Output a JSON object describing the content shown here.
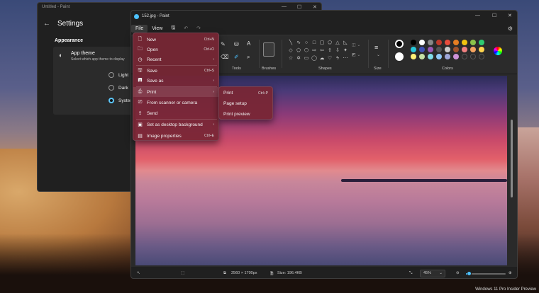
{
  "desktop": {
    "watermark": "Windows 11 Pro Insider Preview"
  },
  "settings": {
    "window_title": "Untitled - Paint",
    "controls": {
      "min": "—",
      "max": "☐",
      "close": "✕"
    },
    "back_icon": "arrow-left-icon",
    "title": "Settings",
    "section": "Appearance",
    "card": {
      "title": "App theme",
      "subtitle": "Select which app theme to display",
      "icon": "palette-icon"
    },
    "options": [
      {
        "label": "Light",
        "selected": false
      },
      {
        "label": "Dark",
        "selected": false
      },
      {
        "label": "System setting",
        "selected": true
      }
    ]
  },
  "paint": {
    "title": "152.jpg - Paint",
    "controls": {
      "min": "—",
      "max": "☐",
      "close": "✕"
    },
    "menu": {
      "file": "File",
      "view": "View"
    },
    "ribbon": {
      "tools_label": "Tools",
      "brushes_label": "Brushes",
      "shapes_label": "Shapes",
      "size_label": "Size",
      "colors_label": "Colors"
    },
    "colors": {
      "primary": "#000000",
      "secondary": "#ffffff",
      "palette": [
        "#000000",
        "#ffffff",
        "#888888",
        "#c0392b",
        "#e74c3c",
        "#e67e22",
        "#f1c40f",
        "#8bc34a",
        "#2ecc71",
        "#26c6da",
        "#3f51b5",
        "#9b59b6",
        "#555555",
        "#cccccc",
        "#a0522d",
        "#f08080",
        "#f4a460",
        "#ffd54f",
        "#fff176",
        "#c5e1a5",
        "#80deea",
        "#90caf9",
        "#9fa8da",
        "#ce93d8"
      ]
    },
    "status": {
      "dimensions": "2560 × 1700px",
      "size": "Size: 196.4KB",
      "zoom": "45%",
      "zoom_fraction": 0.08
    }
  },
  "file_menu": {
    "items": [
      {
        "label": "New",
        "shortcut": "Ctrl+N",
        "icon": "new-file-icon"
      },
      {
        "label": "Open",
        "shortcut": "Ctrl+O",
        "icon": "folder-icon"
      },
      {
        "label": "Recent",
        "shortcut": "›",
        "icon": "clock-icon"
      },
      {
        "label": "Save",
        "shortcut": "Ctrl+S",
        "icon": "save-icon"
      },
      {
        "label": "Save as",
        "shortcut": "›",
        "icon": "save-as-icon"
      },
      {
        "label": "Print",
        "shortcut": "›",
        "icon": "print-icon"
      },
      {
        "label": "From scanner or camera",
        "shortcut": "",
        "icon": "scanner-icon"
      },
      {
        "label": "Send",
        "shortcut": "",
        "icon": "send-icon"
      },
      {
        "label": "Set as desktop background",
        "shortcut": "›",
        "icon": "desktop-icon"
      },
      {
        "label": "Image properties",
        "shortcut": "Ctrl+E",
        "icon": "properties-icon"
      }
    ]
  },
  "print_submenu": {
    "items": [
      {
        "label": "Print",
        "shortcut": "Ctrl+P"
      },
      {
        "label": "Page setup",
        "shortcut": ""
      },
      {
        "label": "Print preview",
        "shortcut": ""
      }
    ]
  }
}
